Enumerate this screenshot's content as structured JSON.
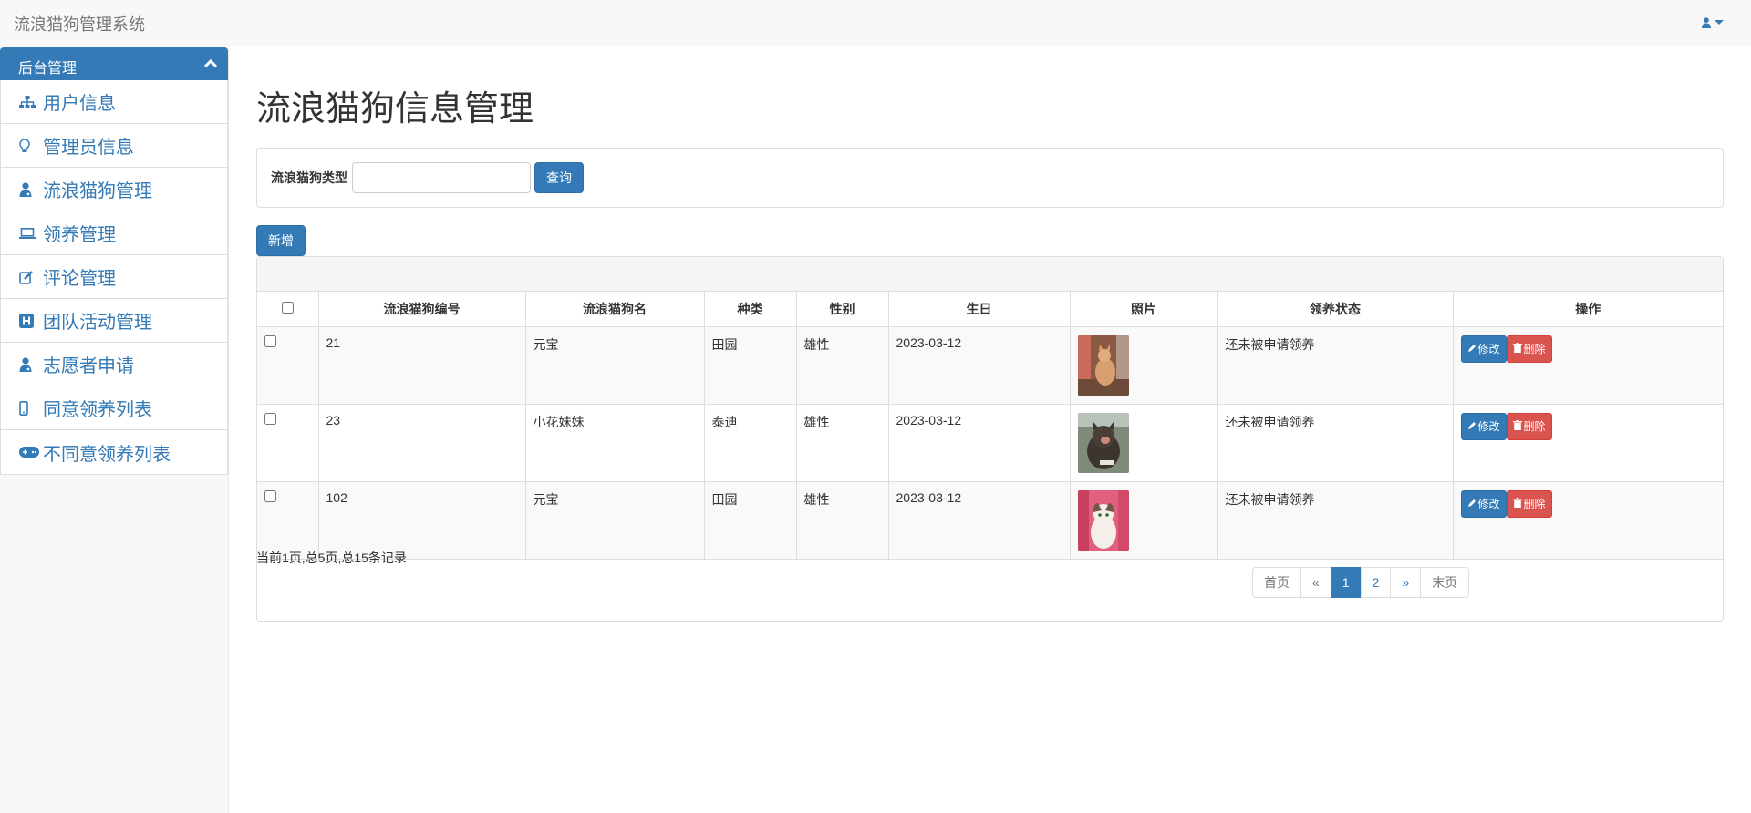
{
  "navbar": {
    "brand": "流浪猫狗管理系统",
    "user_icon": "user-icon"
  },
  "sidebar": {
    "panel_title": "后台管理",
    "items": [
      {
        "label": "用户信息",
        "icon": "sitemap-icon"
      },
      {
        "label": "管理员信息",
        "icon": "lightbulb-icon"
      },
      {
        "label": "流浪猫狗管理",
        "icon": "user-doctor-icon"
      },
      {
        "label": "领养管理",
        "icon": "laptop-icon"
      },
      {
        "label": "评论管理",
        "icon": "edit-icon"
      },
      {
        "label": "团队活动管理",
        "icon": "h-square-icon"
      },
      {
        "label": "志愿者申请",
        "icon": "user-doctor-icon"
      },
      {
        "label": "同意领养列表",
        "icon": "mobile-icon"
      },
      {
        "label": "不同意领养列表",
        "icon": "gamepad-icon"
      }
    ]
  },
  "main": {
    "title": "流浪猫狗信息管理",
    "search": {
      "label": "流浪猫狗类型",
      "value": "",
      "placeholder": "",
      "button": "查询"
    },
    "add_button": "新增",
    "table": {
      "headers": [
        "流浪猫狗编号",
        "流浪猫狗名",
        "种类",
        "性别",
        "生日",
        "照片",
        "领养状态",
        "操作"
      ],
      "rows": [
        {
          "id": "21",
          "name": "元宝",
          "kind": "田园",
          "gender": "雄性",
          "birthday": "2023-03-12",
          "status": "还未被申请领养"
        },
        {
          "id": "23",
          "name": "小花妹妹",
          "kind": "泰迪",
          "gender": "雄性",
          "birthday": "2023-03-12",
          "status": "还未被申请领养"
        },
        {
          "id": "102",
          "name": "元宝",
          "kind": "田园",
          "gender": "雄性",
          "birthday": "2023-03-12",
          "status": "还未被申请领养"
        }
      ],
      "edit_label": "修改",
      "delete_label": "删除"
    },
    "page_info": "当前1页,总5页,总15条记录",
    "pagination": {
      "first": "首页",
      "prev": "«",
      "pages": [
        "1",
        "2"
      ],
      "current": "1",
      "next": "»",
      "last": "末页"
    }
  },
  "colors": {
    "primary": "#337ab7",
    "danger": "#d9534f"
  }
}
